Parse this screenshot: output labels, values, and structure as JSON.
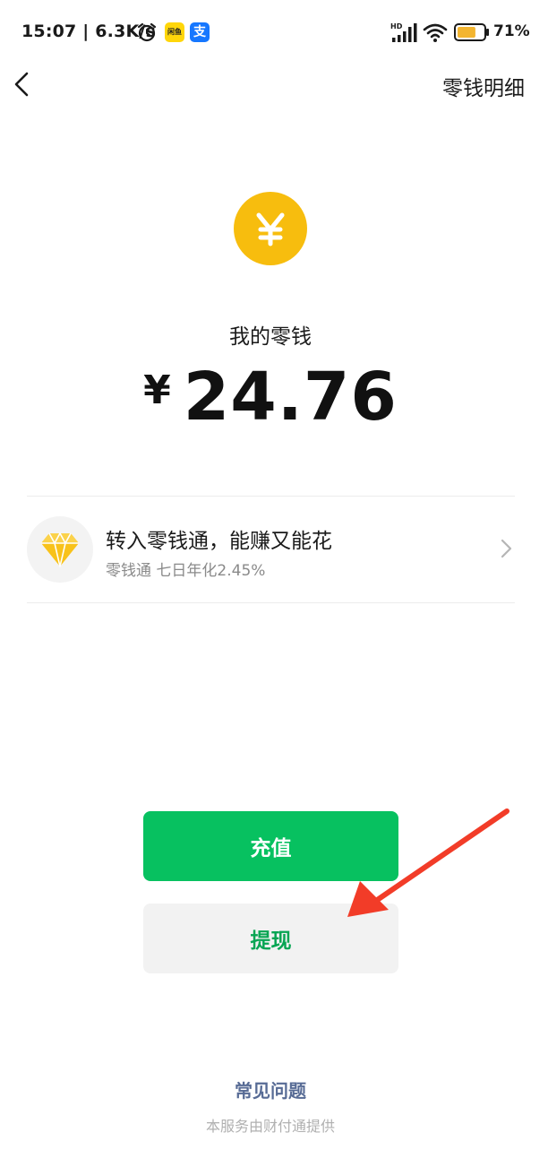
{
  "status_bar": {
    "time_speed": "15:07 | 6.3K/s",
    "app_badge_yellow": "闲鱼",
    "app_badge_blue": "支",
    "battery_percent": "71%",
    "battery_level": 0.71,
    "icons": [
      "alarm-icon",
      "signal-icon",
      "wifi-icon",
      "battery-icon"
    ]
  },
  "nav": {
    "back_icon": "chevron-left-icon",
    "right_label": "零钱明细"
  },
  "wallet": {
    "icon": "yuan-coin-icon",
    "label": "我的零钱",
    "currency_symbol": "¥",
    "amount": "24.76"
  },
  "promo": {
    "icon": "diamond-icon",
    "title": "转入零钱通，能赚又能花",
    "subtitle": "零钱通 七日年化2.45%",
    "chevron": "chevron-right-icon"
  },
  "actions": {
    "recharge_label": "充值",
    "withdraw_label": "提现"
  },
  "footer": {
    "faq_label": "常见问题",
    "provider_note": "本服务由财付通提供"
  },
  "colors": {
    "primary_green": "#07c160",
    "coin_yellow": "#f7bd0e",
    "link_blue": "#576b95",
    "annotation_red": "#f23c28"
  }
}
